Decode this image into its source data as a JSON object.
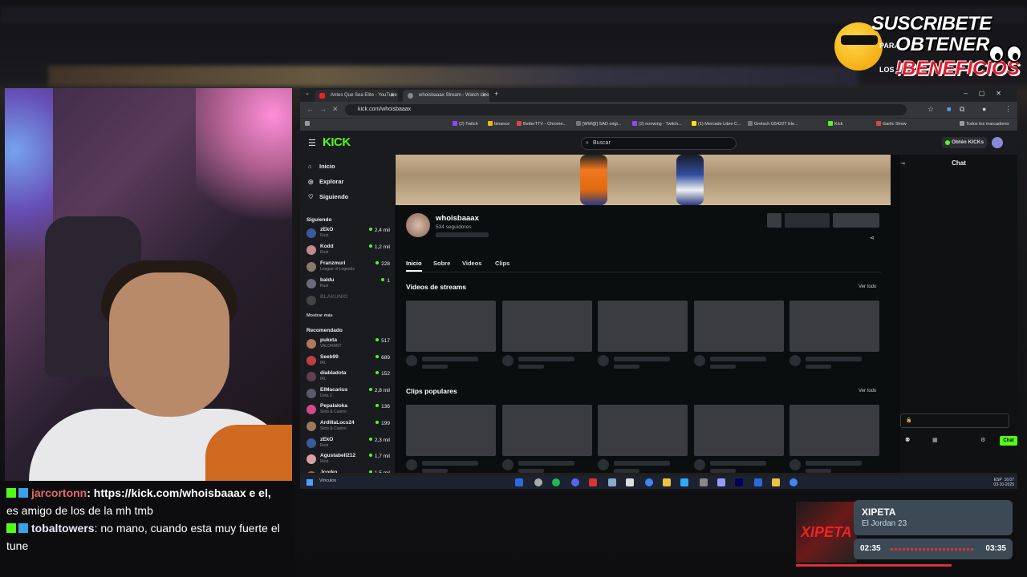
{
  "banner": {
    "line1": "SUSCRIBETE",
    "para": "PARA",
    "line2": "OBTENER",
    "los": "LOS",
    "line3": "!BENEFICIOS"
  },
  "browser": {
    "tabs": [
      {
        "label": "Antes Que Sea Elite - YouTube"
      },
      {
        "label": "whoisbaaax Stream - Watch Live"
      }
    ],
    "url": "kick.com/whoisbaaax",
    "bookmarks": [
      "(2) Twitch",
      "binance",
      "BetterTTV - Chrome...",
      "[WW@] SAD origi...",
      "(2) nonwing - Twitch...",
      "(1) Mercado Libre C...",
      "Gretsch G5422T Ele...",
      "Kick",
      "Garlic Show",
      "Todos los marcadores"
    ]
  },
  "kick": {
    "logo": "KICK",
    "search_placeholder": "Buscar",
    "obtain_kicks": "Obtén KICKs",
    "nav": [
      {
        "icon": "⌂",
        "label": "Inicio"
      },
      {
        "icon": "◎",
        "label": "Explorar"
      },
      {
        "icon": "♡",
        "label": "Siguiendo"
      }
    ],
    "following_title": "Siguiendo",
    "following": [
      {
        "name": "zEkO",
        "game": "Rust",
        "viewers": "2,4 mil",
        "color": "#3a5a9a"
      },
      {
        "name": "Kodd",
        "game": "Rust",
        "viewers": "1,2 mil",
        "color": "#c08a8a"
      },
      {
        "name": "Franzmuri",
        "game": "League of Legends",
        "viewers": "228",
        "color": "#8a7a6a"
      },
      {
        "name": "baldu",
        "game": "Rust",
        "viewers": "1",
        "color": "#6a6a7a"
      },
      {
        "name": "BLAKUNIO",
        "game": "",
        "viewers": "",
        "color": "#444"
      }
    ],
    "show_more": "Mostrar más",
    "recommended_title": "Recomendado",
    "recommended": [
      {
        "name": "puketa",
        "game": "VALORANT",
        "viewers": "517",
        "color": "#b07a5a"
      },
      {
        "name": "Seeb99",
        "game": "IRL",
        "viewers": "689",
        "color": "#c04040"
      },
      {
        "name": "diabladota",
        "game": "IRL",
        "viewers": "152",
        "color": "#604050"
      },
      {
        "name": "ElMacarius",
        "game": "Dota 2",
        "viewers": "2,8 mil",
        "color": "#5a5a6a"
      },
      {
        "name": "Pepalaloka",
        "game": "Slots & Casino",
        "viewers": "136",
        "color": "#d04a8a"
      },
      {
        "name": "ArdillaLocs24",
        "game": "Slots & Casino",
        "viewers": "199",
        "color": "#9a7a5a"
      },
      {
        "name": "zEkO",
        "game": "Rust",
        "viewers": "2,3 mil",
        "color": "#3a5a9a"
      },
      {
        "name": "Agustabell212",
        "game": "Rust",
        "viewers": "1,7 mil",
        "color": "#d8a0a0"
      },
      {
        "name": "Jcorko",
        "game": "",
        "viewers": "1,5 mil",
        "color": "#a06a4a"
      }
    ],
    "channel": {
      "name": "whoisbaaax",
      "followers": "534 seguidores",
      "tabs": [
        "Inicio",
        "Sobre",
        "Videos",
        "Clips"
      ]
    },
    "sections": [
      {
        "title": "Videos de streams",
        "see_all": "Ver todo"
      },
      {
        "title": "Clips populares",
        "see_all": "Ver todo"
      }
    ],
    "chat_title": "Chat",
    "chat_send": "Chat"
  },
  "taskbar": {
    "search": "Vínculos",
    "lang": "ESP",
    "time": "16:07",
    "date": "03-10-2025"
  },
  "stream_chat": [
    {
      "user": "jarcortonn",
      "text": ": https://kick.com/whoisbaaax e el,"
    },
    {
      "user": "",
      "text": "es amigo de los de la mh tmb"
    },
    {
      "user": "tobaltowers",
      "text": ": no mano, cuando esta muy fuerte el"
    },
    {
      "user": "",
      "text": "tune"
    }
  ],
  "music": {
    "title": "XIPETA",
    "artist": "El Jordan 23",
    "elapsed": "02:35",
    "total": "03:35",
    "cover_text": "XIPETA",
    "progress": 0.72
  }
}
